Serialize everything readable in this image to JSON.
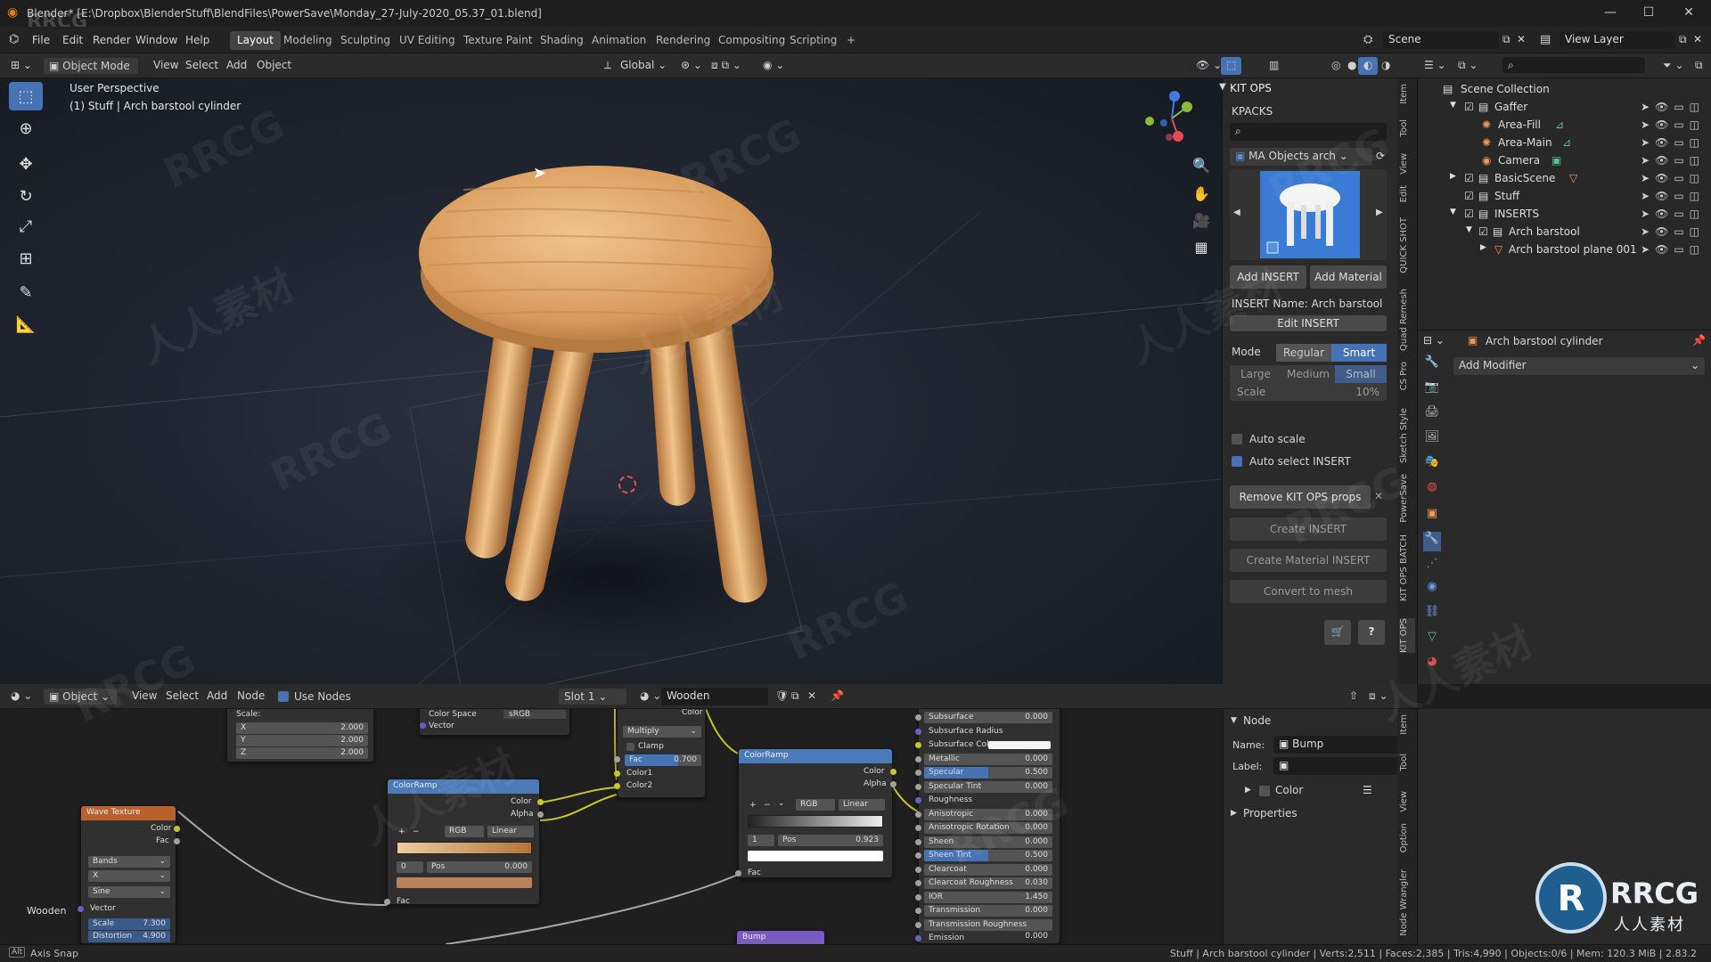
{
  "window": {
    "title": "Blender* [E:\\Dropbox\\BlenderStuff\\BlendFiles\\PowerSave\\Monday_27-July-2020_05.37_01.blend]",
    "watermark_corner": "RRCG"
  },
  "menu": {
    "items": [
      "File",
      "Edit",
      "Render",
      "Window",
      "Help"
    ],
    "workspaces": [
      "Layout",
      "Modeling",
      "Sculpting",
      "UV Editing",
      "Texture Paint",
      "Shading",
      "Animation",
      "Rendering",
      "Compositing",
      "Scripting"
    ],
    "active_workspace": "Layout",
    "add_tab": "+",
    "scene": "Scene",
    "view_layer": "View Layer"
  },
  "viewport_header": {
    "mode": "Object Mode",
    "menus": [
      "View",
      "Select",
      "Add",
      "Object"
    ],
    "transform": "Global"
  },
  "viewport": {
    "perspective": "User Perspective",
    "object_info": "(1) Stuff | Arch barstool cylinder"
  },
  "kitops": {
    "panel_title": "KIT OPS",
    "kpacks_label": "KPACKS",
    "kpack_selected": "MA Objects arch",
    "add_insert": "Add INSERT",
    "add_material": "Add Material",
    "insert_name": "INSERT Name: Arch barstool",
    "edit_insert": "Edit INSERT",
    "mode_label": "Mode",
    "mode_regular": "Regular",
    "mode_smart": "Smart",
    "size_large": "Large",
    "size_medium": "Medium",
    "size_small": "Small",
    "scale_label": "Scale",
    "scale_value": "10%",
    "auto_scale": "Auto scale",
    "auto_select": "Auto select INSERT",
    "remove_props": "Remove KIT OPS props",
    "create_insert": "Create INSERT",
    "create_material_insert": "Create Material INSERT",
    "convert_to_mesh": "Convert to mesh",
    "help": "?"
  },
  "side_tabs": [
    "Item",
    "Tool",
    "View",
    "Edit",
    "QUICK SHOT",
    "Quad Remesh",
    "CS Pro",
    "Sketch Style",
    "PowerSave",
    "KIT OPS BATCH",
    "KIT OPS"
  ],
  "outliner": {
    "root": "Scene Collection",
    "items": [
      {
        "name": "Gaffer",
        "indent": 1
      },
      {
        "name": "Area-Fill",
        "indent": 2
      },
      {
        "name": "Area-Main",
        "indent": 2
      },
      {
        "name": "Camera",
        "indent": 2
      },
      {
        "name": "BasicScene",
        "indent": 1
      },
      {
        "name": "Stuff",
        "indent": 1
      },
      {
        "name": "INSERTS",
        "indent": 1
      },
      {
        "name": "Arch barstool",
        "indent": 2
      },
      {
        "name": "Arch barstool plane 001",
        "indent": 3
      }
    ]
  },
  "properties": {
    "object_name": "Arch barstool cylinder",
    "add_modifier": "Add Modifier"
  },
  "node_header": {
    "type": "Object",
    "menus": [
      "View",
      "Select",
      "Add",
      "Node"
    ],
    "use_nodes": "Use Nodes",
    "slot": "Slot 1",
    "material": "Wooden"
  },
  "nodes": {
    "mapping": {
      "scale_label": "Scale:",
      "x_label": "X",
      "x": "2.000",
      "y_label": "Y",
      "y": "2.000",
      "z_label": "Z",
      "z": "2.000"
    },
    "image": {
      "color_space_label": "Color Space",
      "color_space": "sRGB",
      "vector": "Vector"
    },
    "mix": {
      "top_label": "Color",
      "blend": "Multiply",
      "clamp": "Clamp",
      "fac_label": "Fac",
      "fac": "0.700",
      "color1": "Color1",
      "color2": "Color2"
    },
    "wave": {
      "title": "Wave Texture",
      "out_color": "Color",
      "out_fac": "Fac",
      "bands": "Bands",
      "axis": "X",
      "profile": "Sine",
      "vector": "Vector",
      "scale_label": "Scale",
      "scale": "7.300",
      "distortion_label": "Distortion",
      "distortion": "4.900"
    },
    "ramp1": {
      "title": "ColorRamp",
      "out_color": "Color",
      "out_alpha": "Alpha",
      "plus": "+",
      "minus": "−",
      "mode": "RGB",
      "interp": "Linear",
      "idx": "0",
      "pos_label": "Pos",
      "pos": "0.000",
      "fac": "Fac"
    },
    "ramp2": {
      "title": "ColorRamp",
      "out_color": "Color",
      "out_alpha": "Alpha",
      "plus": "+",
      "minus": "−",
      "menu": "⌄",
      "mode": "RGB",
      "interp": "Linear",
      "idx": "1",
      "pos_label": "Pos",
      "pos": "0.923",
      "fac": "Fac"
    },
    "bump": {
      "title": "Bump"
    },
    "frame_label": "Wooden",
    "bsdf": [
      {
        "label": "Subsurface",
        "value": "0.000"
      },
      {
        "label": "Subsurface Radius",
        "value": ""
      },
      {
        "label": "Subsurface Color",
        "value": ""
      },
      {
        "label": "Metallic",
        "value": "0.000"
      },
      {
        "label": "Specular",
        "value": "0.500"
      },
      {
        "label": "Specular Tint",
        "value": "0.000"
      },
      {
        "label": "Roughness",
        "value": ""
      },
      {
        "label": "Anisotropic",
        "value": "0.000"
      },
      {
        "label": "Anisotropic Rotation",
        "value": "0.000"
      },
      {
        "label": "Sheen",
        "value": "0.000"
      },
      {
        "label": "Sheen Tint",
        "value": "0.500"
      },
      {
        "label": "Clearcoat",
        "value": "0.000"
      },
      {
        "label": "Clearcoat Roughness",
        "value": "0.030"
      },
      {
        "label": "IOR",
        "value": "1.450"
      },
      {
        "label": "Transmission",
        "value": "0.000"
      },
      {
        "label": "Transmission Roughness",
        "value": "0.000"
      },
      {
        "label": "Emission",
        "value": ""
      }
    ]
  },
  "node_panel": {
    "section": "Node",
    "name_label": "Name:",
    "name": "Bump",
    "label_label": "Label:",
    "label": "",
    "color": "Color",
    "properties": "Properties"
  },
  "node_tabs": [
    "Item",
    "Tool",
    "View",
    "Option",
    "Node Wrangler"
  ],
  "status": {
    "left": "Axis Snap",
    "right": "Stuff | Arch barstool cylinder | Verts:2,511 | Faces:2,385 | Tris:4,990 | Objects:0/6 | Mem: 120.3 MiB | 2.83.2"
  },
  "logo": {
    "main": "RRCG",
    "sub": "人人素材"
  },
  "watermarks": [
    "RRCG",
    "人人素材"
  ]
}
